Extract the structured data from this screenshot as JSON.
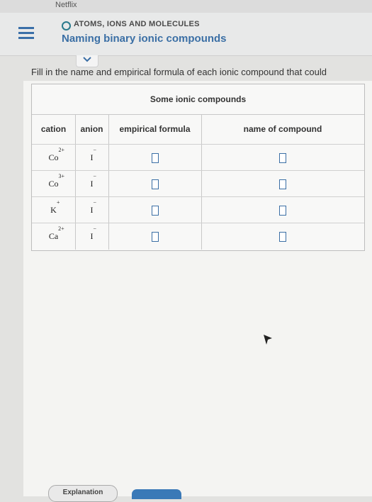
{
  "system": {
    "app_label": "Netflix"
  },
  "header": {
    "topic": "ATOMS, IONS AND MOLECULES",
    "title": "Naming binary ionic compounds"
  },
  "instruction": "Fill in the name and empirical formula of each ionic compound that could",
  "table": {
    "title": "Some ionic compounds",
    "columns": [
      "cation",
      "anion",
      "empirical formula",
      "name of compound"
    ],
    "rows": [
      {
        "cation": "Co",
        "cation_charge": "2+",
        "anion": "I",
        "anion_charge": "−"
      },
      {
        "cation": "Co",
        "cation_charge": "3+",
        "anion": "I",
        "anion_charge": "−"
      },
      {
        "cation": "K",
        "cation_charge": "+",
        "anion": "I",
        "anion_charge": "−"
      },
      {
        "cation": "Ca",
        "cation_charge": "2+",
        "anion": "I",
        "anion_charge": "−"
      }
    ]
  },
  "footer": {
    "explanation_label": "Explanation"
  },
  "colors": {
    "accent": "#3b6fa5",
    "teal": "#2a7a8c"
  }
}
